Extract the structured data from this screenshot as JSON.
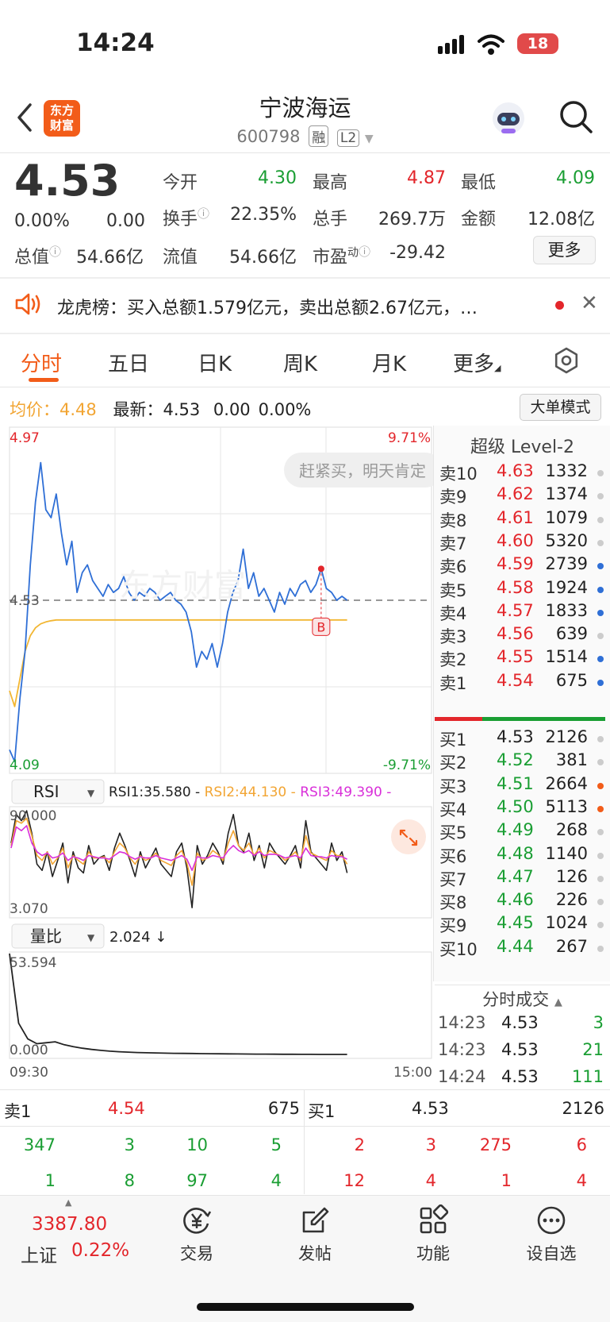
{
  "status_bar": {
    "time": "14:24",
    "battery": "18"
  },
  "header": {
    "stock_name": "宁波海运",
    "stock_code": "600798",
    "tag_rong": "融",
    "tag_l2": "L2",
    "logo_text": "东方财富",
    "back_icon": "chevron-left-icon",
    "search_icon": "search-icon"
  },
  "quote": {
    "price": "4.53",
    "change_pct": "0.00%",
    "change": "0.00",
    "open_label": "今开",
    "open": "4.30",
    "high_label": "最高",
    "high": "4.87",
    "low_label": "最低",
    "low": "4.09",
    "turnover_label": "换手",
    "turnover": "22.35%",
    "volume_label": "总手",
    "volume": "269.7万",
    "amount_label": "金额",
    "amount": "12.08亿",
    "total_cap_label": "总值",
    "total_cap": "54.66亿",
    "float_cap_label": "流值",
    "float_cap": "54.66亿",
    "pe_label": "市盈",
    "pe_sup": "动",
    "pe": "-29.42",
    "more_button": "更多"
  },
  "notice": {
    "text": "龙虎榜：买入总额1.579亿元，卖出总额2.67亿元，…"
  },
  "tabs": [
    "分时",
    "五日",
    "日K",
    "周K",
    "月K",
    "更多"
  ],
  "info_row": {
    "avg_label": "均价：",
    "avg": "4.48",
    "latest_label": "最新：",
    "latest": "4.53",
    "latest_change": "0.00",
    "latest_pct": "0.00%"
  },
  "mode_button": "大单模式",
  "chart_data": [
    {
      "type": "line",
      "y_top_label": "4.97",
      "y_bottom_label": "4.09",
      "y_mid_label": "4.53",
      "pct_top": "9.71%",
      "pct_bottom": "-9.71%",
      "ylim": [
        4.09,
        4.97
      ],
      "bubble_text": "赶紧买，明天肯定",
      "marker": "B",
      "x_start": "09:30",
      "x_end": "15:00",
      "series": [
        {
          "values": [
            4.15,
            4.12,
            4.28,
            4.4,
            4.62,
            4.78,
            4.88,
            4.76,
            4.74,
            4.8,
            4.7,
            4.62,
            4.68,
            4.55,
            4.6,
            4.62,
            4.58,
            4.56,
            4.54,
            4.57,
            4.55,
            4.56,
            4.59,
            4.55,
            4.53,
            4.55,
            4.54,
            4.56,
            4.55,
            4.53,
            4.54,
            4.55,
            4.53,
            4.52,
            4.5,
            4.45,
            4.36,
            4.4,
            4.38,
            4.42,
            4.36,
            4.42,
            4.5,
            4.55,
            4.58,
            4.66,
            4.56,
            4.6,
            4.54,
            4.56,
            4.53,
            4.5,
            4.55,
            4.52,
            4.56,
            4.54,
            4.57,
            4.58,
            4.55,
            4.57,
            4.61,
            4.56,
            4.55,
            4.53,
            4.54,
            4.53
          ]
        },
        {
          "values": [
            4.3,
            4.26,
            4.33,
            4.4,
            4.44,
            4.46,
            4.47,
            4.475,
            4.478,
            4.48,
            4.48,
            4.48,
            4.48,
            4.48,
            4.48,
            4.48,
            4.48,
            4.48,
            4.48,
            4.48,
            4.48,
            4.48,
            4.48,
            4.48,
            4.48,
            4.48,
            4.48,
            4.48,
            4.48,
            4.48,
            4.48,
            4.48,
            4.48,
            4.48,
            4.48,
            4.48,
            4.48,
            4.48,
            4.48,
            4.48,
            4.48,
            4.48,
            4.48,
            4.48,
            4.48,
            4.48,
            4.48,
            4.48,
            4.48,
            4.48,
            4.48,
            4.48,
            4.48,
            4.48,
            4.48,
            4.48,
            4.48,
            4.48,
            4.48,
            4.48,
            4.48,
            4.48,
            4.48,
            4.48,
            4.48,
            4.48
          ]
        }
      ]
    },
    {
      "type": "line",
      "indicator": "RSI",
      "rsi1": "RSI1:35.580",
      "rsi2": "RSI2:44.130",
      "rsi3": "RSI3:49.390",
      "y_top_label": "90.000",
      "y_bottom_label": "3.070",
      "ylim": [
        3.07,
        90
      ],
      "series": [
        {
          "values": [
            62,
            85,
            80,
            88,
            70,
            45,
            40,
            55,
            35,
            48,
            62,
            30,
            55,
            42,
            38,
            60,
            45,
            50,
            52,
            40,
            58,
            70,
            60,
            48,
            35,
            55,
            42,
            50,
            58,
            45,
            40,
            35,
            55,
            62,
            42,
            10,
            60,
            45,
            52,
            62,
            55,
            45,
            70,
            85,
            60,
            55,
            70,
            48,
            60,
            42,
            62,
            55,
            50,
            45,
            52,
            60,
            42,
            80,
            55,
            50,
            45,
            40,
            62,
            48,
            55,
            38
          ]
        },
        {
          "values": [
            60,
            80,
            78,
            82,
            68,
            52,
            48,
            55,
            45,
            50,
            58,
            42,
            52,
            48,
            45,
            55,
            50,
            50,
            51,
            46,
            55,
            62,
            58,
            50,
            45,
            52,
            48,
            50,
            54,
            48,
            46,
            44,
            52,
            56,
            46,
            28,
            54,
            48,
            50,
            56,
            53,
            48,
            62,
            72,
            60,
            56,
            62,
            52,
            58,
            50,
            56,
            54,
            52,
            48,
            51,
            55,
            48,
            68,
            54,
            52,
            50,
            48,
            56,
            52,
            52,
            45
          ]
        },
        {
          "values": [
            58,
            75,
            72,
            76,
            62,
            55,
            52,
            54,
            50,
            51,
            54,
            48,
            51,
            50,
            48,
            52,
            51,
            50,
            50,
            49,
            52,
            55,
            54,
            51,
            49,
            51,
            50,
            50,
            52,
            50,
            49,
            48,
            50,
            52,
            49,
            40,
            51,
            50,
            50,
            52,
            51,
            50,
            56,
            60,
            56,
            54,
            56,
            52,
            55,
            52,
            53,
            53,
            52,
            50,
            51,
            52,
            50,
            58,
            52,
            51,
            51,
            50,
            52,
            51,
            51,
            49
          ]
        }
      ]
    },
    {
      "type": "line",
      "indicator": "量比",
      "value_text": "2.024 ↓",
      "y_top_label": "53.594",
      "y_bottom_label": "0.000",
      "ylim": [
        0,
        53.594
      ],
      "series": [
        {
          "values": [
            53.59,
            18,
            10,
            7.5,
            8,
            8.5,
            7,
            6,
            5.2,
            4.6,
            4.1,
            3.7,
            3.4,
            3.2,
            3.0,
            2.9,
            2.8,
            2.7,
            2.6,
            2.55,
            2.5,
            2.45,
            2.4,
            2.35,
            2.3,
            2.27,
            2.24,
            2.2,
            2.18,
            2.15,
            2.13,
            2.1,
            2.08,
            2.06,
            2.05,
            2.04,
            2.03,
            2.024
          ]
        }
      ]
    }
  ],
  "level2": {
    "title": "超级 Level-2",
    "asks": [
      {
        "label": "卖10",
        "price": "4.63",
        "vol": "1332",
        "dot": "#cccccc"
      },
      {
        "label": "卖9",
        "price": "4.62",
        "vol": "1374",
        "dot": "#cccccc"
      },
      {
        "label": "卖8",
        "price": "4.61",
        "vol": "1079",
        "dot": "#cccccc"
      },
      {
        "label": "卖7",
        "price": "4.60",
        "vol": "5320",
        "dot": "#cccccc"
      },
      {
        "label": "卖6",
        "price": "4.59",
        "vol": "2739",
        "dot": "#2f6fd6"
      },
      {
        "label": "卖5",
        "price": "4.58",
        "vol": "1924",
        "dot": "#2f6fd6"
      },
      {
        "label": "卖4",
        "price": "4.57",
        "vol": "1833",
        "dot": "#2f6fd6"
      },
      {
        "label": "卖3",
        "price": "4.56",
        "vol": "639",
        "dot": "#cccccc"
      },
      {
        "label": "卖2",
        "price": "4.55",
        "vol": "1514",
        "dot": "#2f6fd6"
      },
      {
        "label": "卖1",
        "price": "4.54",
        "vol": "675",
        "dot": "#2f6fd6"
      }
    ],
    "bids": [
      {
        "label": "买1",
        "price": "4.53",
        "vol": "2126",
        "dot": "#cccccc"
      },
      {
        "label": "买2",
        "price": "4.52",
        "vol": "381",
        "dot": "#cccccc"
      },
      {
        "label": "买3",
        "price": "4.51",
        "vol": "2664",
        "dot": "#f25c19"
      },
      {
        "label": "买4",
        "price": "4.50",
        "vol": "5113",
        "dot": "#f25c19"
      },
      {
        "label": "买5",
        "price": "4.49",
        "vol": "268",
        "dot": "#cccccc"
      },
      {
        "label": "买6",
        "price": "4.48",
        "vol": "1140",
        "dot": "#cccccc"
      },
      {
        "label": "买7",
        "price": "4.47",
        "vol": "126",
        "dot": "#cccccc"
      },
      {
        "label": "买8",
        "price": "4.46",
        "vol": "226",
        "dot": "#cccccc"
      },
      {
        "label": "买9",
        "price": "4.45",
        "vol": "1024",
        "dot": "#cccccc"
      },
      {
        "label": "买10",
        "price": "4.44",
        "vol": "267",
        "dot": "#cccccc"
      }
    ],
    "ticks_title": "分时成交",
    "ticks": [
      {
        "time": "14:23",
        "price": "4.53",
        "vol": "3"
      },
      {
        "time": "14:23",
        "price": "4.53",
        "vol": "21"
      },
      {
        "time": "14:24",
        "price": "4.53",
        "vol": "111"
      }
    ]
  },
  "queue": {
    "sell_label": "卖1",
    "sell_price": "4.54",
    "sell_vol": "675",
    "buy_label": "买1",
    "buy_price": "4.53",
    "buy_vol": "2126",
    "sell_rows": [
      [
        "347",
        "3",
        "10",
        "5"
      ],
      [
        "1",
        "8",
        "97",
        "4"
      ]
    ],
    "buy_rows": [
      [
        "2",
        "3",
        "275",
        "6"
      ],
      [
        "12",
        "4",
        "1",
        "4"
      ]
    ]
  },
  "bottom_nav": {
    "index_value": "3387.80",
    "index_name": "上证",
    "index_pct": "0.22%",
    "items": [
      {
        "label": "交易",
        "icon": "trade-yen-icon"
      },
      {
        "label": "发帖",
        "icon": "compose-icon"
      },
      {
        "label": "功能",
        "icon": "grid-icon"
      },
      {
        "label": "设自选",
        "icon": "more-dots-icon"
      }
    ]
  },
  "colors": {
    "up": "#e3262b",
    "down": "#1a9e33",
    "accent": "#f25c19",
    "price_line": "#2f6fd6",
    "avg_line": "#f2b632",
    "rsi2": "#f2a533",
    "rsi3": "#d92fd9"
  }
}
